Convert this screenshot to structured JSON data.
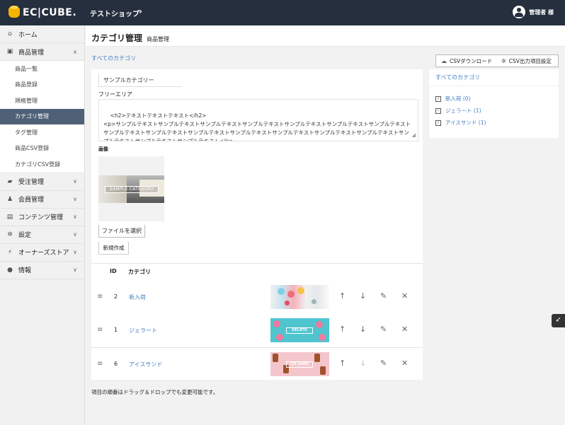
{
  "header": {
    "logo_text": "EC|CUBE.",
    "shop_name": "テストショップ",
    "shop_chevron": "›",
    "user_name": "管理者 様"
  },
  "sidebar": {
    "items": [
      {
        "label": "ホーム",
        "icon": "home-icon",
        "glyph": "⌂"
      },
      {
        "label": "商品管理",
        "icon": "cube-icon",
        "glyph": "▣",
        "chevron": "∧"
      },
      {
        "label": "受注管理",
        "icon": "cart-icon",
        "glyph": "▰",
        "chevron": "∨"
      },
      {
        "label": "会員管理",
        "icon": "users-icon",
        "glyph": "♟",
        "chevron": "∨"
      },
      {
        "label": "コンテンツ管理",
        "icon": "file-icon",
        "glyph": "▤",
        "chevron": "∨"
      },
      {
        "label": "設定",
        "icon": "gear-icon",
        "glyph": "✲",
        "chevron": "∨"
      },
      {
        "label": "オーナーズストア",
        "icon": "plug-icon",
        "glyph": "⚡",
        "chevron": "∨"
      },
      {
        "label": "情報",
        "icon": "info-icon",
        "glyph": "●",
        "chevron": "∨"
      }
    ],
    "product_sub": [
      "商品一覧",
      "商品登録",
      "規格管理",
      "カテゴリ管理",
      "タグ管理",
      "商品CSV登録",
      "カテゴリCSV登録"
    ]
  },
  "page": {
    "title": "カテゴリ管理",
    "subtitle": "商品管理",
    "breadcrumb": "すべてのカテゴリ"
  },
  "form": {
    "category_name_value": "サンプルカテゴリー",
    "free_area_label": "フリーエリア",
    "free_area_value": "<h2>テキストテキストテキスト</h2>\n<p>サンプルテキストサンプルテキストサンプルテキストサンプルテキストサンプルテキストサンプルテキストサンプルテキストサンプルテキストサンプルテキストサンプルテキストサンプルテキストサンプルテキストサンプルテキストサンプルテキストサンプルテキストサンプルテキストサンプルテキスト</p>",
    "image_label": "画像",
    "preview_text": "SAMPLE CATEGORY",
    "file_button": "ファイルを選択",
    "new_button": "新規作成"
  },
  "table": {
    "col_id": "ID",
    "col_category": "カテゴリ",
    "rows": [
      {
        "id": "2",
        "name": "新入荷",
        "thumb_text": ""
      },
      {
        "id": "1",
        "name": "ジェラート",
        "thumb_text": "GELATO"
      },
      {
        "id": "6",
        "name": "アイスサンド",
        "thumb_text": "ICE SAND"
      }
    ],
    "action_glyphs": {
      "up": "↑",
      "down": "↓",
      "edit": "✎",
      "delete": "✕",
      "handle": "≡"
    }
  },
  "footnote": "項目の順番はドラッグ＆ドロップでも変更可能です。",
  "right_panel": {
    "csv_download": "CSVダウンロード",
    "csv_settings": "CSV出力項目設定",
    "all_categories": "すべてのカテゴリ",
    "categories": [
      "新入荷 (0)",
      "ジェラート (1)",
      "アイスサンド (1)"
    ]
  },
  "colors": {
    "header_bg": "#262f3e",
    "link": "#437ec4",
    "active_nav": "#4f6177"
  }
}
